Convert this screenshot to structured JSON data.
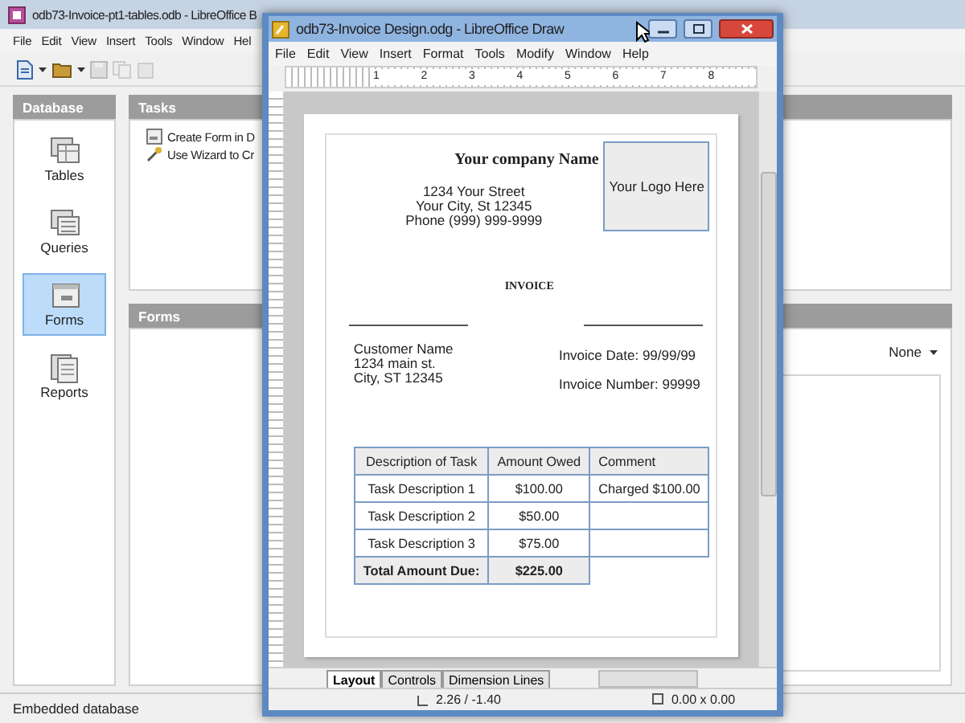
{
  "base_window": {
    "title": "odb73-Invoice-pt1-tables.odb - LibreOffice B",
    "menu": [
      "File",
      "Edit",
      "View",
      "Insert",
      "Tools",
      "Window",
      "Hel"
    ],
    "database_panel": {
      "title": "Database",
      "items": [
        {
          "label": "Tables",
          "kind": "tables",
          "selected": false
        },
        {
          "label": "Queries",
          "kind": "queries",
          "selected": false
        },
        {
          "label": "Forms",
          "kind": "forms",
          "selected": true
        },
        {
          "label": "Reports",
          "kind": "reports",
          "selected": false
        }
      ]
    },
    "tasks_panel": {
      "title": "Tasks",
      "items": [
        "Create Form in D",
        "Use Wizard to Cr"
      ]
    },
    "forms_panel": {
      "title": "Forms",
      "preview": "None"
    },
    "status_bar": "Embedded database"
  },
  "draw_window": {
    "title": "odb73-Invoice Design.odg - LibreOffice Draw",
    "menu": [
      "File",
      "Edit",
      "View",
      "Insert",
      "Format",
      "Tools",
      "Modify",
      "Window",
      "Help"
    ],
    "ruler_labels": [
      "1",
      "2",
      "3",
      "4",
      "5",
      "6",
      "7",
      "8"
    ],
    "document": {
      "company_name": "Your company Name",
      "address_lines": [
        "1234 Your Street",
        "Your City, St 12345",
        "Phone (999) 999-9999"
      ],
      "logo_text": "Your Logo Here",
      "heading": "INVOICE",
      "customer_lines": [
        "Customer Name",
        "1234 main st.",
        "City, ST 12345"
      ],
      "invoice_date": "Invoice Date: 99/99/99",
      "invoice_number": "Invoice Number: 99999",
      "table": {
        "columns": [
          "Description of Task",
          "Amount Owed",
          "Comment"
        ],
        "rows": [
          [
            "Task Description 1",
            "$100.00",
            "Charged $100.00"
          ],
          [
            "Task Description 2",
            "$50.00",
            ""
          ],
          [
            "Task Description 3",
            "$75.00",
            ""
          ]
        ],
        "total": {
          "label": "Total Amount Due:",
          "amount": "$225.00"
        }
      }
    },
    "layer_tabs": [
      {
        "label": "Layout",
        "selected": true
      },
      {
        "label": "Controls",
        "selected": false
      },
      {
        "label": "Dimension Lines",
        "selected": false
      }
    ],
    "status": {
      "position": "2.26 / -1.40",
      "size": "0.00 x 0.00"
    }
  }
}
